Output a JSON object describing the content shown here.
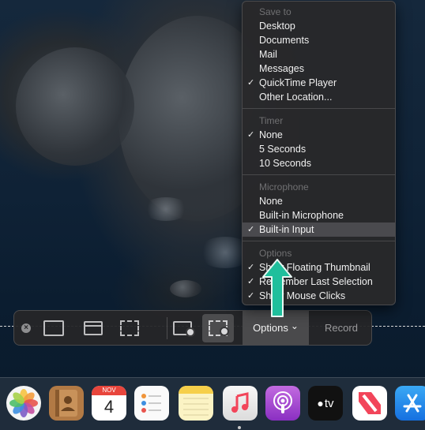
{
  "menu": {
    "save_to": {
      "header": "Save to",
      "items": [
        {
          "label": "Desktop",
          "checked": false
        },
        {
          "label": "Documents",
          "checked": false
        },
        {
          "label": "Mail",
          "checked": false
        },
        {
          "label": "Messages",
          "checked": false
        },
        {
          "label": "QuickTime Player",
          "checked": true
        },
        {
          "label": "Other Location...",
          "checked": false
        }
      ]
    },
    "timer": {
      "header": "Timer",
      "items": [
        {
          "label": "None",
          "checked": true
        },
        {
          "label": "5 Seconds",
          "checked": false
        },
        {
          "label": "10 Seconds",
          "checked": false
        }
      ]
    },
    "microphone": {
      "header": "Microphone",
      "items": [
        {
          "label": "None",
          "checked": false
        },
        {
          "label": "Built-in Microphone",
          "checked": false
        },
        {
          "label": "Built-in Input",
          "checked": true,
          "highlighted": true
        }
      ]
    },
    "options": {
      "header": "Options",
      "items": [
        {
          "label": "Show Floating Thumbnail",
          "checked": true
        },
        {
          "label": "Remember Last Selection",
          "checked": true
        },
        {
          "label": "Show Mouse Clicks",
          "checked": true
        }
      ]
    },
    "check_glyph": "✓"
  },
  "toolbar": {
    "close_glyph": "×",
    "options_label": "Options",
    "options_chevron": "⌄",
    "record_label": "Record",
    "icons": [
      "close-icon",
      "capture-entire-screen-icon",
      "capture-window-icon",
      "capture-selection-icon",
      "record-entire-screen-icon",
      "record-selection-icon"
    ]
  },
  "annotation": {
    "arrow_color": "#1fbf9c"
  },
  "dock": {
    "calendar_month": "NOV",
    "calendar_day": "4",
    "tv_label": "tv",
    "apps": [
      "photos-icon",
      "contacts-icon",
      "calendar-icon",
      "reminders-icon",
      "notes-icon",
      "music-icon",
      "podcasts-icon",
      "apple-tv-icon",
      "news-icon",
      "app-store-icon"
    ]
  }
}
